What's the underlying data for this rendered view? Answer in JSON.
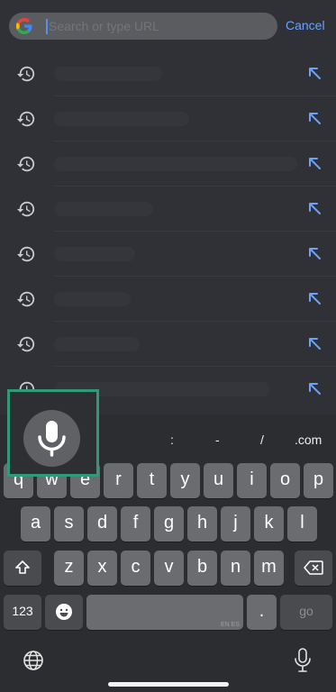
{
  "search": {
    "placeholder": "Search or type URL",
    "cancel_label": "Cancel"
  },
  "suggestions": [
    {
      "icon": "history-icon",
      "action": "fill-arrow-icon"
    },
    {
      "icon": "history-icon",
      "action": "fill-arrow-icon"
    },
    {
      "icon": "history-icon",
      "action": "fill-arrow-icon"
    },
    {
      "icon": "history-icon",
      "action": "fill-arrow-icon"
    },
    {
      "icon": "history-icon",
      "action": "fill-arrow-icon"
    },
    {
      "icon": "history-icon",
      "action": "fill-arrow-icon"
    },
    {
      "icon": "history-icon",
      "action": "fill-arrow-icon"
    },
    {
      "icon": "history-icon",
      "action": "fill-arrow-icon"
    }
  ],
  "keyboard": {
    "suggestion_keys": [
      ":",
      "-",
      "/",
      ".com"
    ],
    "row1": [
      "q",
      "w",
      "e",
      "r",
      "t",
      "y",
      "u",
      "i",
      "o",
      "p"
    ],
    "row2": [
      "a",
      "s",
      "d",
      "f",
      "g",
      "h",
      "j",
      "k",
      "l"
    ],
    "row3": [
      "z",
      "x",
      "c",
      "v",
      "b",
      "n",
      "m"
    ],
    "numbers_label": "123",
    "space_label": "EN ES",
    "period_label": ".",
    "go_label": "go"
  },
  "colors": {
    "accent": "#6aa2ff",
    "highlight": "#2f9a76",
    "background": "#2f3136"
  }
}
